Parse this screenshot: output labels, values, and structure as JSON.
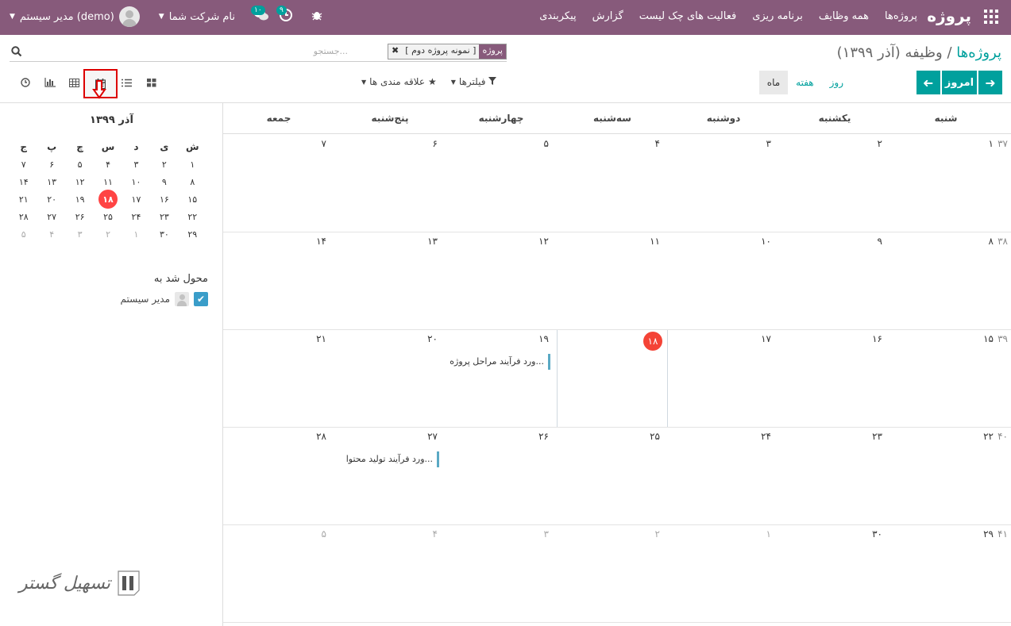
{
  "topbar": {
    "brand": "پروژه",
    "menu": [
      "پروژه‌ها",
      "همه وظایف",
      "برنامه ریزی",
      "فعالیت های چک لیست",
      "گزارش",
      "پیکربندی"
    ],
    "company": "نام شرکت شما",
    "user": "مدیر سیستم (demo)",
    "messages_badge": "۱۰",
    "activities_badge": "۹"
  },
  "control": {
    "breadcrumb_root": "پروژه‌ها",
    "breadcrumb_separator": "/",
    "breadcrumb_current": "وظیفه (آذر ۱۳۹۹)",
    "facet_label": "پروژه",
    "facet_value": "[ نمونه پروژه دوم ]",
    "search_placeholder": "جستجو...",
    "today_label": "امروز",
    "scale_day": "روز",
    "scale_week": "هفته",
    "scale_month": "ماه",
    "filters_label": "فیلترها",
    "favorites_label": "علاقه مندی ها"
  },
  "sidebar": {
    "month_title": "آذر ۱۳۹۹",
    "weekday_heads": [
      "ش",
      "ی",
      "د",
      "س",
      "چ",
      "پ",
      "ج"
    ],
    "weeks": [
      [
        "۱",
        "۲",
        "۳",
        "۴",
        "۵",
        "۶",
        "۷"
      ],
      [
        "۸",
        "۹",
        "۱۰",
        "۱۱",
        "۱۲",
        "۱۳",
        "۱۴"
      ],
      [
        "۱۵",
        "۱۶",
        "۱۷",
        "۱۸",
        "۱۹",
        "۲۰",
        "۲۱"
      ],
      [
        "۲۲",
        "۲۳",
        "۲۴",
        "۲۵",
        "۲۶",
        "۲۷",
        "۲۸"
      ],
      [
        "۲۹",
        "۳۰",
        "۱",
        "۲",
        "۳",
        "۴",
        "۵"
      ]
    ],
    "today": "۱۸",
    "assigned_title": "محول شد به",
    "assigned_user": "مدیر سیستم",
    "logo_text": "تسهیل گستر"
  },
  "calendar": {
    "weekdays": [
      "شنبه",
      "یکشنبه",
      "دوشنبه",
      "سه‌شنبه",
      "چهارشنبه",
      "پنج‌شنبه",
      "جمعه"
    ],
    "weeks": [
      {
        "num": "۳۷",
        "days": [
          "۱",
          "۲",
          "۳",
          "۴",
          "۵",
          "۶",
          "۷"
        ]
      },
      {
        "num": "۳۸",
        "days": [
          "۸",
          "۹",
          "۱۰",
          "۱۱",
          "۱۲",
          "۱۳",
          "۱۴"
        ]
      },
      {
        "num": "۳۹",
        "days": [
          "۱۵",
          "۱۶",
          "۱۷",
          "۱۸",
          "۱۹",
          "۲۰",
          "۲۱"
        ]
      },
      {
        "num": "۴۰",
        "days": [
          "۲۲",
          "۲۳",
          "۲۴",
          "۲۵",
          "۲۶",
          "۲۷",
          "۲۸"
        ]
      },
      {
        "num": "۴۱",
        "days": [
          "۲۹",
          "۳۰",
          "۱",
          "۲",
          "۳",
          "۴",
          "۵"
        ]
      }
    ],
    "today": "۱۸",
    "events": [
      {
        "week": 2,
        "day": 4,
        "title": "...ورد فرآیند مراحل پروژه"
      },
      {
        "week": 3,
        "day": 5,
        "title": "...ورد فرآیند تولید محتوا"
      }
    ]
  }
}
